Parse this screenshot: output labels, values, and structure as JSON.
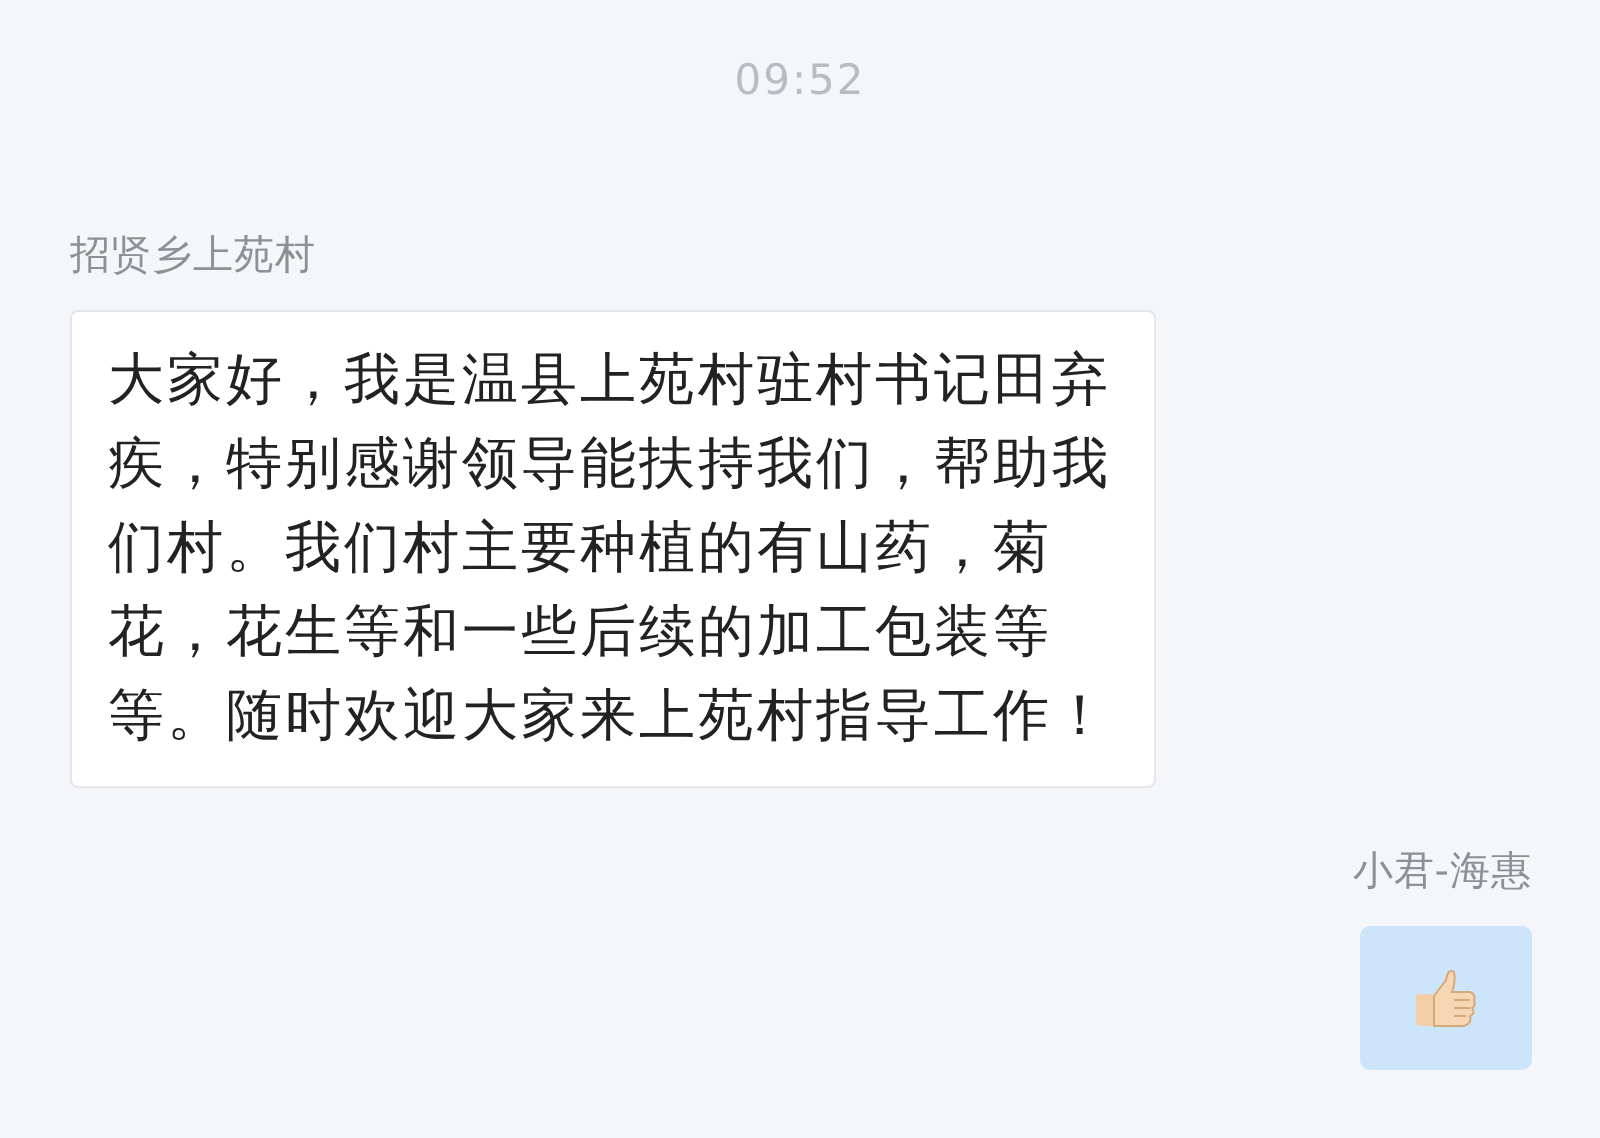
{
  "time": "09:52",
  "messages": [
    {
      "sender": "招贤乡上苑村",
      "outgoing": false,
      "kind": "text",
      "text": "大家好，我是温县上苑村驻村书记田弃疾，特别感谢领导能扶持我们，帮助我们村。我们村主要种植的有山药，菊花，花生等和一些后续的加工包装等等。随时欢迎大家来上苑村指导工作！"
    },
    {
      "sender": "小君-海惠",
      "outgoing": true,
      "kind": "sticker"
    }
  ]
}
